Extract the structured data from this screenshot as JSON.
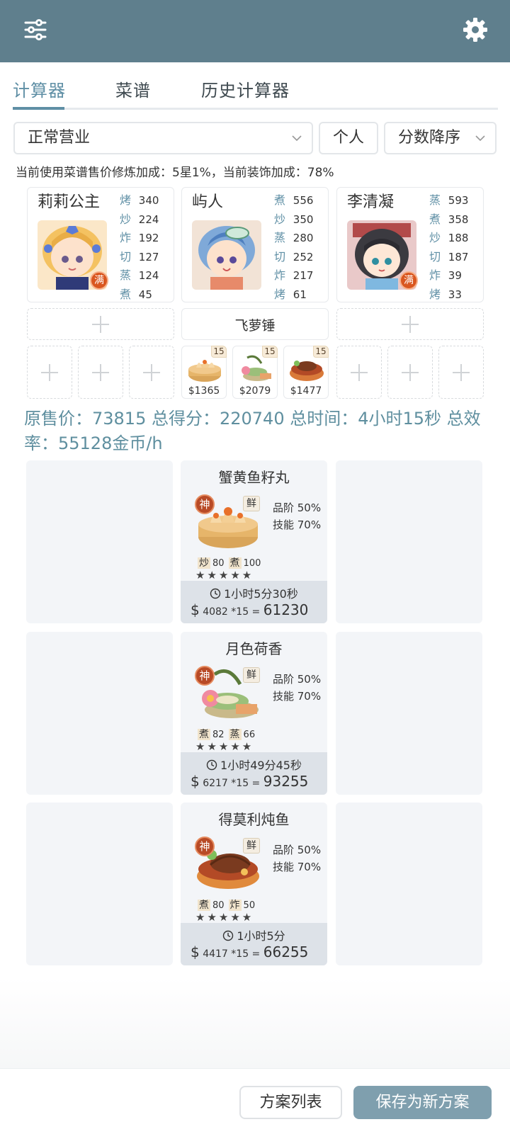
{
  "tabs": [
    {
      "label": "计算器",
      "active": true
    },
    {
      "label": "菜谱",
      "active": false
    },
    {
      "label": "历史计算器",
      "active": false
    }
  ],
  "filters": {
    "mode": "正常营业",
    "scope": "个人",
    "sort": "分数降序"
  },
  "note": "当前使用菜谱售价修炼加成：5星1%，当前装饰加成：78%",
  "chefs": [
    {
      "name": "莉莉公主",
      "full_badge": "满",
      "skills": [
        {
          "k": "烤",
          "v": "340"
        },
        {
          "k": "炒",
          "v": "224"
        },
        {
          "k": "炸",
          "v": "192"
        },
        {
          "k": "切",
          "v": "127"
        },
        {
          "k": "蒸",
          "v": "124"
        },
        {
          "k": "煮",
          "v": "45"
        }
      ]
    },
    {
      "name": "屿人",
      "full_badge": "",
      "skills": [
        {
          "k": "煮",
          "v": "556"
        },
        {
          "k": "炒",
          "v": "350"
        },
        {
          "k": "蒸",
          "v": "280"
        },
        {
          "k": "切",
          "v": "252"
        },
        {
          "k": "炸",
          "v": "217"
        },
        {
          "k": "烤",
          "v": "61"
        }
      ]
    },
    {
      "name": "李清凝",
      "full_badge": "满",
      "skills": [
        {
          "k": "蒸",
          "v": "593"
        },
        {
          "k": "煮",
          "v": "358"
        },
        {
          "k": "炒",
          "v": "188"
        },
        {
          "k": "切",
          "v": "187"
        },
        {
          "k": "炸",
          "v": "39"
        },
        {
          "k": "烤",
          "v": "33"
        }
      ]
    }
  ],
  "equipment": {
    "middle": "飞萝锤"
  },
  "slots": [
    {
      "price": "$1365",
      "qty": "15"
    },
    {
      "price": "$2079",
      "qty": "15"
    },
    {
      "price": "$1477",
      "qty": "15"
    }
  ],
  "summary": "原售价：73815 总得分：220740 总时间：4小时15秒 总效率：55128金币/h",
  "dishes": [
    {
      "title": "蟹黄鱼籽丸",
      "shen": "神",
      "xian": "鲜",
      "quality": "品阶 50%",
      "skill": "技能 70%",
      "req1_k": "炒",
      "req1_v": "80",
      "req2_k": "煮",
      "req2_v": "100",
      "stars": "★★★★★",
      "time": "1小时5分30秒",
      "unit": "4082",
      "mult": "*15",
      "total": "61230"
    },
    {
      "title": "月色荷香",
      "shen": "神",
      "xian": "鲜",
      "quality": "品阶 50%",
      "skill": "技能 70%",
      "req1_k": "煮",
      "req1_v": "82",
      "req2_k": "蒸",
      "req2_v": "66",
      "stars": "★★★★★",
      "time": "1小时49分45秒",
      "unit": "6217",
      "mult": "*15",
      "total": "93255"
    },
    {
      "title": "得莫利炖鱼",
      "shen": "神",
      "xian": "鲜",
      "quality": "品阶 50%",
      "skill": "技能 70%",
      "req1_k": "煮",
      "req1_v": "80",
      "req2_k": "炸",
      "req2_v": "50",
      "stars": "★★★★★",
      "time": "1小时5分",
      "unit": "4417",
      "mult": "*15",
      "total": "66255"
    }
  ],
  "buttons": {
    "list": "方案列表",
    "save": "保存为新方案"
  },
  "colors": {
    "header": "#5f7f8d",
    "accent": "#5f8fa5",
    "save_button": "#7f9fae",
    "badge": "#b84a26"
  },
  "icons": [
    "sliders-icon",
    "gear-icon",
    "chevron-down-icon",
    "plus-icon",
    "clock-icon"
  ]
}
